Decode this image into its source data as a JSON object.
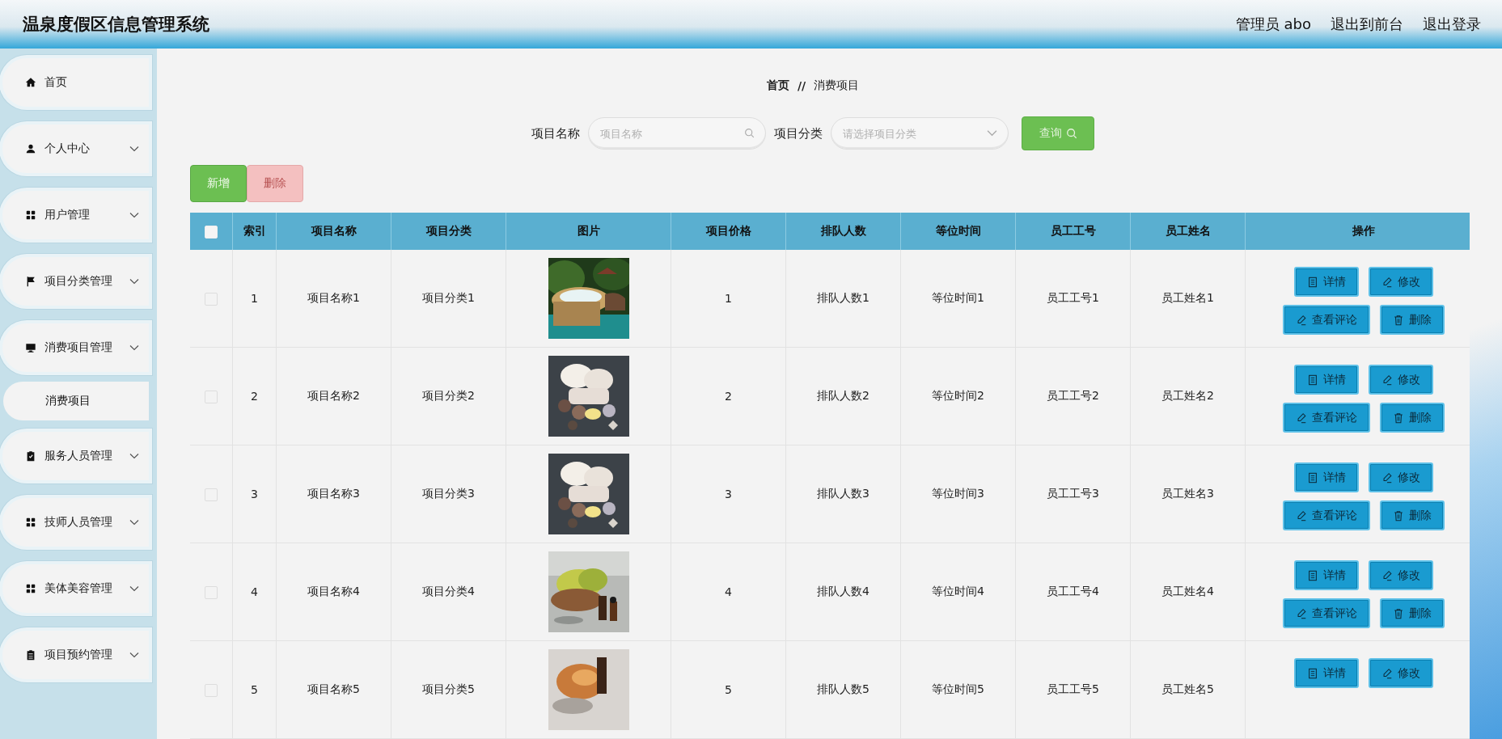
{
  "header": {
    "title": "温泉度假区信息管理系统",
    "links": [
      {
        "label": "管理员 abo"
      },
      {
        "label": "退出到前台"
      },
      {
        "label": "退出登录"
      }
    ]
  },
  "sidebar": {
    "items": [
      {
        "label": "首页",
        "kind": "link"
      },
      {
        "label": "个人中心",
        "kind": "menu"
      },
      {
        "label": "用户管理",
        "kind": "menu"
      },
      {
        "label": "项目分类管理",
        "kind": "menu"
      },
      {
        "label": "消费项目管理",
        "kind": "menu",
        "children": [
          {
            "label": "消费项目",
            "selected": true
          }
        ]
      },
      {
        "label": "服务人员管理",
        "kind": "menu"
      },
      {
        "label": "技师人员管理",
        "kind": "menu"
      },
      {
        "label": "美体美容管理",
        "kind": "menu"
      },
      {
        "label": "项目预约管理",
        "kind": "menu"
      }
    ]
  },
  "breadcrumb": {
    "items": [
      "首页",
      "消费项目"
    ],
    "separator": "//"
  },
  "search": {
    "fields": [
      {
        "label": "项目名称",
        "placeholder": "项目名称",
        "kind": "text"
      },
      {
        "label": "项目分类",
        "placeholder": "请选择项目分类",
        "kind": "select"
      }
    ],
    "button": "查询"
  },
  "actions": [
    {
      "label": "新增",
      "kind": "add",
      "disabled": false
    },
    {
      "label": "删除",
      "kind": "delete",
      "disabled": true
    }
  ],
  "table": {
    "select_all": {
      "checked": false
    },
    "columns": [
      "索引",
      "项目名称",
      "项目分类",
      "图片",
      "项目价格",
      "排队人数",
      "等位时间",
      "员工工号",
      "员工姓名",
      "操作"
    ],
    "rows": [
      {
        "checked": false,
        "cells": [
          "1",
          "项目名称1",
          "项目分类1",
          {
            "kind": "picture"
          },
          "1",
          "排队人数1",
          "等位时间1",
          "员工工号1",
          "员工姓名1"
        ],
        "buttons": [
          "详情",
          "修改",
          "查看评论",
          "删除"
        ]
      },
      {
        "checked": false,
        "cells": [
          "2",
          "项目名称2",
          "项目分类2",
          {
            "kind": "picture"
          },
          "2",
          "排队人数2",
          "等位时间2",
          "员工工号2",
          "员工姓名2"
        ],
        "buttons": [
          "详情",
          "修改",
          "查看评论",
          "删除"
        ]
      },
      {
        "checked": false,
        "cells": [
          "3",
          "项目名称3",
          "项目分类3",
          {
            "kind": "picture"
          },
          "3",
          "排队人数3",
          "等位时间3",
          "员工工号3",
          "员工姓名3"
        ],
        "buttons": [
          "详情",
          "修改",
          "查看评论",
          "删除"
        ]
      },
      {
        "checked": false,
        "cells": [
          "4",
          "项目名称4",
          "项目分类4",
          {
            "kind": "picture"
          },
          "4",
          "排队人数4",
          "等位时间4",
          "员工工号4",
          "员工姓名4"
        ],
        "buttons": [
          "详情",
          "修改",
          "查看评论",
          "删除"
        ]
      },
      {
        "checked": false,
        "cells": [
          "5",
          "项目名称5",
          "项目分类5",
          {
            "kind": "picture"
          },
          "5",
          "排队人数5",
          "等位时间5",
          "员工工号5",
          "员工姓名5"
        ],
        "buttons": [
          "详情",
          "修改"
        ]
      }
    ]
  }
}
